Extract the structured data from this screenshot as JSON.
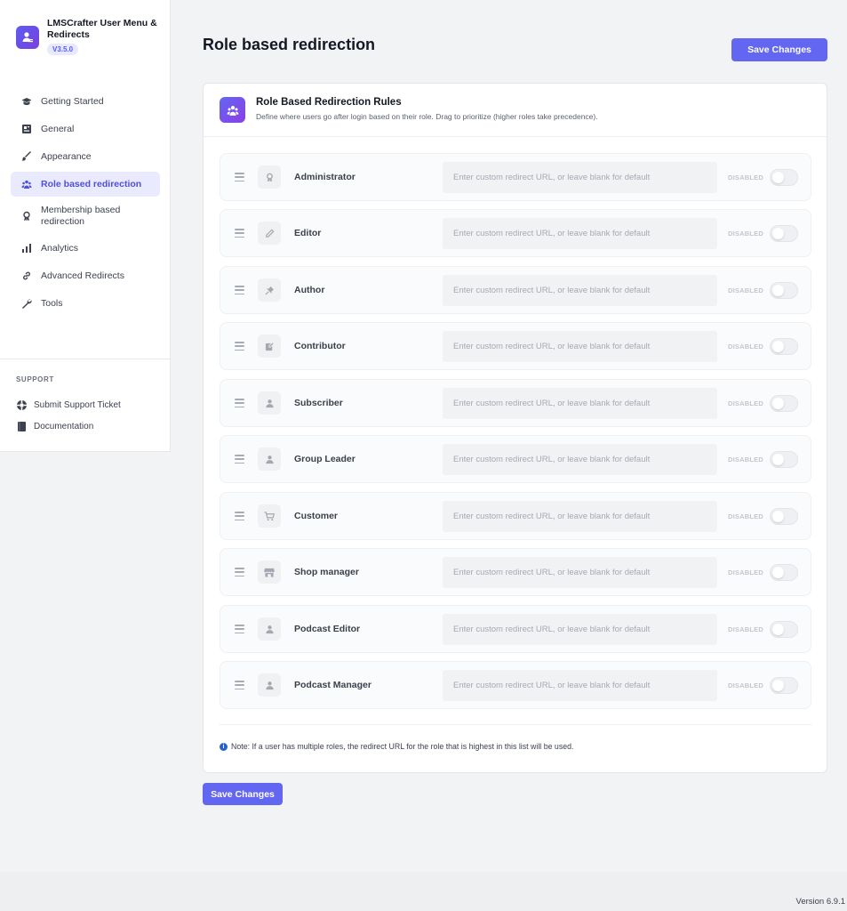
{
  "brand": {
    "title": "LMSCrafter User Menu & Redirects",
    "version": "V3.5.0",
    "accent": "#6366f1"
  },
  "nav": [
    {
      "label": "Getting Started",
      "icon": "graduation-cap-icon",
      "active": false
    },
    {
      "label": "General",
      "icon": "dashboard-icon",
      "active": false
    },
    {
      "label": "Appearance",
      "icon": "brush-icon",
      "active": false
    },
    {
      "label": "Role based redirection",
      "icon": "users-icon",
      "active": true
    },
    {
      "label": "Membership based redirection",
      "icon": "award-icon",
      "active": false
    },
    {
      "label": "Analytics",
      "icon": "bar-chart-icon",
      "active": false
    },
    {
      "label": "Advanced Redirects",
      "icon": "link-icon",
      "active": false
    },
    {
      "label": "Tools",
      "icon": "wrench-icon",
      "active": false
    }
  ],
  "support": {
    "title": "SUPPORT",
    "items": [
      {
        "label": "Submit Support Ticket",
        "icon": "lifebuoy-icon"
      },
      {
        "label": "Documentation",
        "icon": "book-icon"
      }
    ]
  },
  "page": {
    "title": "Role based redirection",
    "save_label": "Save Changes"
  },
  "card": {
    "title": "Role Based Redirection Rules",
    "description": "Define where users go after login based on their role. Drag to prioritize (higher roles take precedence)."
  },
  "rules": [
    {
      "role": "Administrator",
      "icon": "award-icon",
      "placeholder": "Enter custom redirect URL, or leave blank for default",
      "value": "",
      "status": "DISABLED",
      "enabled": false
    },
    {
      "role": "Editor",
      "icon": "pencil-icon",
      "placeholder": "Enter custom redirect URL, or leave blank for default",
      "value": "",
      "status": "DISABLED",
      "enabled": false
    },
    {
      "role": "Author",
      "icon": "pin-icon",
      "placeholder": "Enter custom redirect URL, or leave blank for default",
      "value": "",
      "status": "DISABLED",
      "enabled": false
    },
    {
      "role": "Contributor",
      "icon": "edit-square-icon",
      "placeholder": "Enter custom redirect URL, or leave blank for default",
      "value": "",
      "status": "DISABLED",
      "enabled": false
    },
    {
      "role": "Subscriber",
      "icon": "user-icon",
      "placeholder": "Enter custom redirect URL, or leave blank for default",
      "value": "",
      "status": "DISABLED",
      "enabled": false
    },
    {
      "role": "Group Leader",
      "icon": "user-icon",
      "placeholder": "Enter custom redirect URL, or leave blank for default",
      "value": "",
      "status": "DISABLED",
      "enabled": false
    },
    {
      "role": "Customer",
      "icon": "cart-icon",
      "placeholder": "Enter custom redirect URL, or leave blank for default",
      "value": "",
      "status": "DISABLED",
      "enabled": false
    },
    {
      "role": "Shop manager",
      "icon": "store-icon",
      "placeholder": "Enter custom redirect URL, or leave blank for default",
      "value": "",
      "status": "DISABLED",
      "enabled": false
    },
    {
      "role": "Podcast Editor",
      "icon": "user-icon",
      "placeholder": "Enter custom redirect URL, or leave blank for default",
      "value": "",
      "status": "DISABLED",
      "enabled": false
    },
    {
      "role": "Podcast Manager",
      "icon": "user-icon",
      "placeholder": "Enter custom redirect URL, or leave blank for default",
      "value": "",
      "status": "DISABLED",
      "enabled": false
    }
  ],
  "note": "Note: If a user has multiple roles, the redirect URL for the role that is highest in this list will be used.",
  "footer": {
    "version": "Version 6.9.1"
  }
}
